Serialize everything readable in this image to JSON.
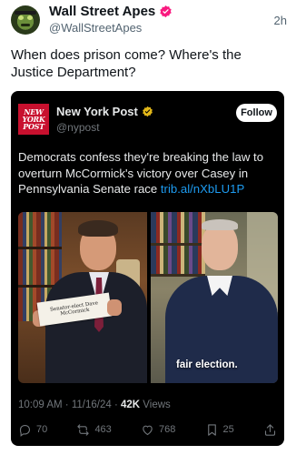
{
  "post": {
    "author_name": "Wall Street Apes",
    "author_handle": "@WallStreetApes",
    "time_ago": "2h",
    "text": "When does prison come? Where's the Justice Department?"
  },
  "quoted": {
    "logo_line1": "NEW",
    "logo_line2": "YORK",
    "logo_line3": "POST",
    "author_name": "New York Post",
    "author_handle": "@nypost",
    "follow_label": "Follow",
    "text": "Democrats confess they're breaking the law to overturn McCormick's victory over Casey in Pennsylvania Senate race ",
    "link": "trib.al/nXbLU1P",
    "media": {
      "sign_text": "Senator-elect Dave McCormick",
      "caption": "fair election."
    },
    "time": "10:09 AM",
    "date": "11/16/24",
    "views_count": "42K",
    "views_label": "Views",
    "stats": {
      "replies": "70",
      "reposts": "463",
      "likes": "768",
      "bookmarks": "25"
    }
  },
  "icons": {
    "reply": "reply-icon",
    "repost": "repost-icon",
    "like": "heart-icon",
    "bookmark": "bookmark-icon",
    "share": "share-icon",
    "verified": "verified-badge-icon"
  },
  "colors": {
    "verified_pink": "#f9197f",
    "verified_gold": "#e2b719",
    "link_blue": "#1d9bf0",
    "nyp_red": "#c8102e"
  }
}
